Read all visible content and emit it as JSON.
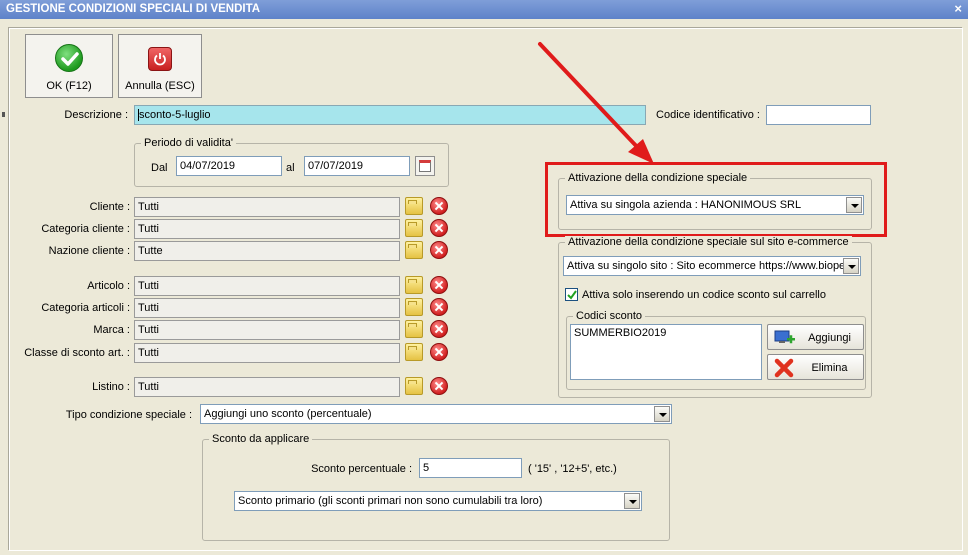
{
  "window": {
    "title": "GESTIONE CONDIZIONI SPECIALI DI VENDITA",
    "close_glyph": "×"
  },
  "toolbar": {
    "ok_label": "OK (F12)",
    "cancel_label": "Annulla (ESC)"
  },
  "form": {
    "descrizione_label": "Descrizione :",
    "descrizione_value": "sconto-5-luglio",
    "codice_label": "Codice identificativo :",
    "codice_value": "",
    "periodo": {
      "title": "Periodo di validita'",
      "dal_label": "Dal",
      "dal_value": "04/07/2019",
      "al_label": "al",
      "al_value": "07/07/2019"
    },
    "rows": [
      {
        "label": "Cliente :",
        "value": "Tutti"
      },
      {
        "label": "Categoria cliente :",
        "value": "Tutti"
      },
      {
        "label": "Nazione cliente :",
        "value": "Tutte"
      },
      {
        "label": "Articolo :",
        "value": "Tutti"
      },
      {
        "label": "Categoria articoli :",
        "value": "Tutti"
      },
      {
        "label": "Marca :",
        "value": "Tutti"
      },
      {
        "label": "Classe di sconto art. :",
        "value": "Tutti"
      },
      {
        "label": "Listino :",
        "value": "Tutti"
      }
    ],
    "tipo_label": "Tipo condizione speciale :",
    "tipo_value": "Aggiungi uno sconto (percentuale)",
    "sconto_group": {
      "title": "Sconto da applicare",
      "perc_label": "Sconto percentuale :",
      "perc_value": "5",
      "hint": "( '15' ,  '12+5', etc.)",
      "tipo_sconto_value": "Sconto primario (gli sconti primari non sono cumulabili tra loro)"
    }
  },
  "attivazione": {
    "title": "Attivazione della condizione speciale",
    "value": "Attiva su singola azienda : HANONIMOUS SRL"
  },
  "ecommerce": {
    "title": "Attivazione della condizione speciale sul sito e-commerce",
    "value": "Attiva su singolo sito : Sito ecommerce https://www.biope",
    "checkbox_label": "Attiva solo inserendo un codice sconto sul carrello",
    "checkbox_checked": true,
    "codici": {
      "title": "Codici sconto",
      "items": [
        "SUMMERBIO2019"
      ],
      "add_label": "Aggiungi",
      "delete_label": "Elimina"
    }
  },
  "colors": {
    "highlight": "#e01b1b",
    "title_bar": "#6f90d0"
  }
}
